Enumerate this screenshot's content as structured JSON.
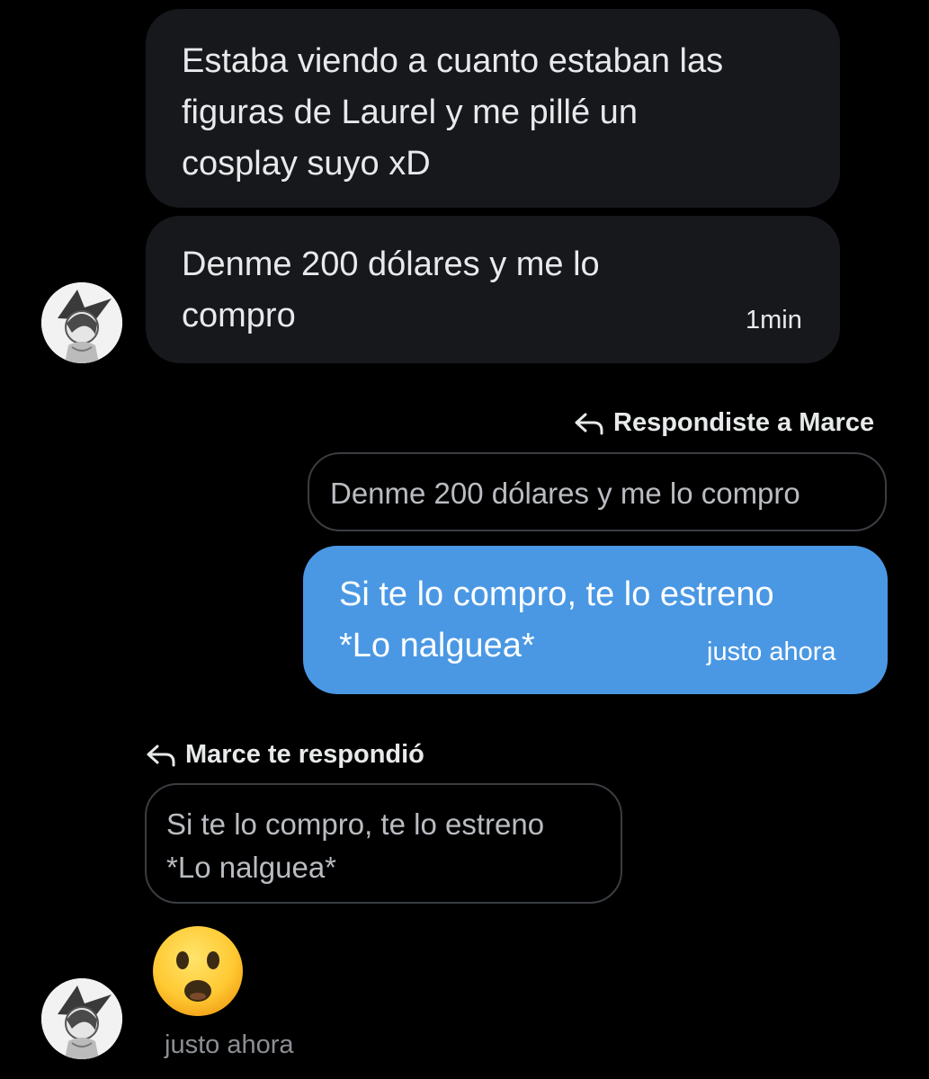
{
  "messages": {
    "incoming_1": {
      "text": "Estaba viendo a cuanto estaban las\nfiguras de Laurel y me pillé un\ncosplay suyo xD"
    },
    "incoming_2": {
      "text": "Denme 200 dólares y me lo\ncompro",
      "time": "1min"
    },
    "outgoing_reply": {
      "header": "Respondiste a Marce",
      "quoted": "Denme 200 dólares y me lo compro",
      "text": "Si te lo compro, te lo estreno\n*Lo nalguea*",
      "time": "justo ahora"
    },
    "incoming_reply": {
      "header": "Marce te respondió",
      "quoted": "Si te lo compro, te lo estreno\n*Lo nalguea*",
      "emoji": "hushed-face",
      "time": "justo ahora"
    }
  },
  "colors": {
    "background": "#000000",
    "incoming_bubble": "#16181c",
    "outgoing_bubble": "#4a98e4",
    "quote_border": "#3a3d42",
    "muted_text": "#8b8f94"
  },
  "icons": {
    "reply": "reply-arrow-icon",
    "avatar": "avatar-anime-portrait"
  }
}
